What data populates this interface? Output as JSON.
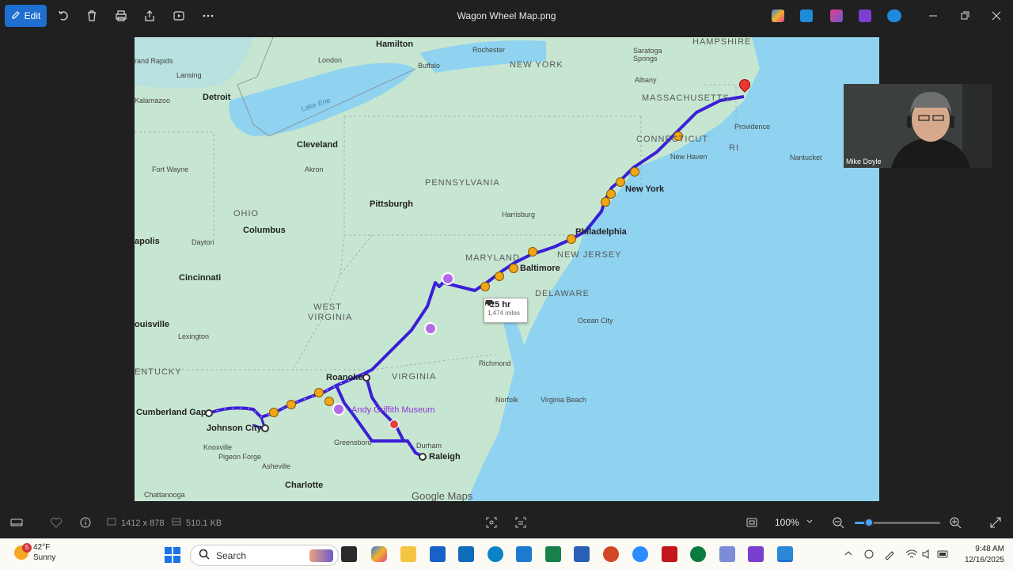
{
  "window": {
    "title": "Wagon Wheel Map.png",
    "edit_label": "Edit"
  },
  "toolbar": {
    "icons": [
      "rotate-icon",
      "delete-icon",
      "print-icon",
      "share-icon",
      "slideshow-icon",
      "more-icon"
    ]
  },
  "map": {
    "states": [
      "HAMPSHIRE",
      "NEW YORK",
      "MASSACHUSETTS",
      "CONNECTICUT",
      "PENNSYLVANIA",
      "OHIO",
      "MARYLAND",
      "NEW JERSEY",
      "DELAWARE",
      "WEST VIRGINIA",
      "VIRGINIA",
      "ENTUCKY",
      "RI"
    ],
    "cities": {
      "hamilton": "Hamilton",
      "rochester": "Rochester",
      "buffalo": "Buffalo",
      "rapids": "rand Rapids",
      "lansing": "Lansing",
      "london": "London",
      "detroit": "Detroit",
      "kalamazoo": "Kalamazoo",
      "saratoga": "Saratoga Springs",
      "albany": "Albany",
      "providence": "Providence",
      "nantucket": "Nantucket",
      "newhaven": "New Haven",
      "newyork": "New York",
      "cleveland": "Cleveland",
      "akron": "Akron",
      "fortwayne": "Fort Wayne",
      "pittsburgh": "Pittsburgh",
      "harrisburg": "Harrisburg",
      "philadelphia": "Philadelphia",
      "columbus": "Columbus",
      "dayton": "Dayton",
      "apolis": "apolis",
      "cincinnati": "Cincinnati",
      "baltimore": "Baltimore",
      "oceancity": "Ocean City",
      "ouisville": "ouisville",
      "lexington": "Lexington",
      "richmond": "Richmond",
      "roanoke": "Roanoke",
      "norfolk": "Norfolk",
      "virginiabeach": "Virginia Beach",
      "cumberland": "Cumberland Gap",
      "johnson": "Johnson City",
      "knoxville": "Knoxville",
      "pigeon": "Pigeon Forge",
      "asheville": "Asheville",
      "greensboro": "Greensboro",
      "durham": "Durham",
      "raleigh": "Raleigh",
      "charlotte": "Charlotte",
      "chattanooga": "Chattanooga"
    },
    "poi": "Andy Griffith Museum",
    "water": "Lake Erie",
    "route": {
      "duration": "25 hr",
      "distance": "1,474 miles"
    },
    "attribution": "Google Maps"
  },
  "webcam": {
    "name": "Mike Doyle"
  },
  "statusbar": {
    "dimensions": "1412 x 878",
    "filesize": "510.1 KB",
    "zoom": "100%",
    "zoom_level": 0.17
  },
  "taskbar": {
    "weather_temp": "42°F",
    "weather_desc": "Sunny",
    "weather_badge": "5",
    "search_label": "Search",
    "time": "9:48 AM",
    "date": "12/16/2025"
  },
  "colors": {
    "accent": "#1f6fd1",
    "route": "#3a1fd6",
    "map_land": "#c7e6d1",
    "map_water": "#8fd3f0",
    "poi": "#8f38d6"
  }
}
